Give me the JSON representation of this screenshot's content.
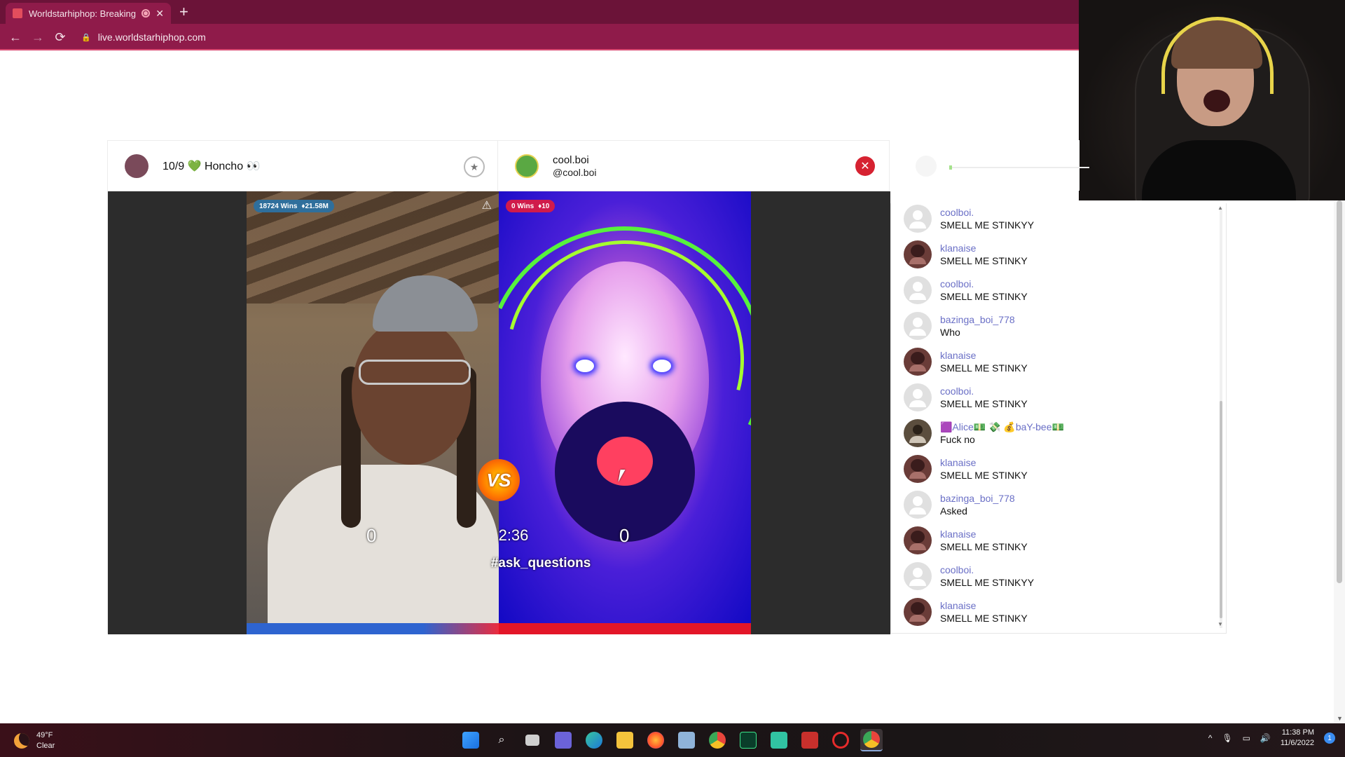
{
  "browser": {
    "tab_title": "Worldstarhiphop: Breaking N",
    "tab_close": "✕",
    "new_tab": "+",
    "back": "←",
    "forward": "→",
    "reload": "⟳",
    "lock_icon": "lock-icon",
    "url": "live.worldstarhiphop.com",
    "accent_color": "#8f1b4a"
  },
  "battle": {
    "left_user": {
      "name": "10/9 💚 Honcho 👀"
    },
    "right_user": {
      "name": "cool.boi",
      "handle": "@cool.boi"
    },
    "star_icon": "★",
    "close_icon": "✕",
    "left_badge": {
      "wins": "18724 Wins",
      "coins": "♦21.58M"
    },
    "right_badge": {
      "wins": "0 Wins",
      "coins": "♦10"
    },
    "warning_icon": "⚠",
    "vs_label": "VS",
    "left_score": "0",
    "right_score": "0",
    "timer": "2:36",
    "hashtag": "#ask_questions",
    "colors": {
      "left": "#2e64d0",
      "right": "#e31628"
    }
  },
  "chat": {
    "messages": [
      {
        "user": "coolboi.",
        "text": "SMELL ME STINKYY"
      },
      {
        "user": "klanaise",
        "text": "SMELL ME STINKY"
      },
      {
        "user": "coolboi.",
        "text": "SMELL ME STINKY"
      },
      {
        "user": "bazinga_boi_778",
        "text": "Who"
      },
      {
        "user": "klanaise",
        "text": "SMELL ME STINKY"
      },
      {
        "user": "coolboi.",
        "text": "SMELL ME STINKY"
      },
      {
        "user": "🟪Alice💵 💸 💰baY-bee💵",
        "text": "Fuck no"
      },
      {
        "user": "klanaise",
        "text": "SMELL ME STINKY"
      },
      {
        "user": "bazinga_boi_778",
        "text": "Asked"
      },
      {
        "user": "klanaise",
        "text": "SMELL ME STINKY"
      },
      {
        "user": "coolboi.",
        "text": "SMELL ME STINKYY"
      },
      {
        "user": "klanaise",
        "text": "SMELL ME STINKY"
      }
    ],
    "username_color": "#6a6fc6"
  },
  "taskbar": {
    "weather_temp": "49°F",
    "weather_desc": "Clear",
    "time": "11:38 PM",
    "date": "11/6/2022",
    "notification_count": "1",
    "tray_up": "^",
    "icons": [
      "windows-start-icon",
      "search-icon",
      "task-view-icon",
      "teams-chat-icon",
      "edge-icon",
      "file-explorer-icon",
      "firefox-icon",
      "photos-icon",
      "chrome-icon",
      "audition-icon",
      "streamlabs-icon",
      "voicemeeter-icon",
      "opera-icon",
      "chrome-active-icon"
    ]
  }
}
